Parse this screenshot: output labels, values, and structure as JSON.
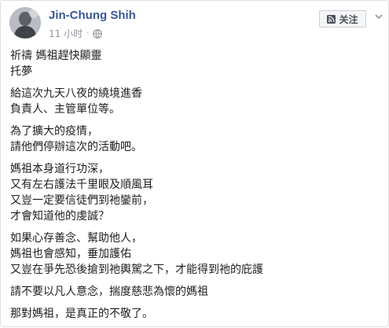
{
  "post": {
    "author": "Jin-Chung Shih",
    "timestamp": "11 小时",
    "privacy_icon": "globe-icon",
    "follow_label": "关注",
    "follow_icon": "rss-icon",
    "more_icon": "chevron-down-icon",
    "paragraphs": [
      [
        "祈禱 媽祖趕快顯靈",
        "托夢"
      ],
      [
        "給這次九天八夜的繞境進香",
        "負責人、主管單位等。"
      ],
      [
        "為了擴大的疫情，",
        "請他們停辦這次的活動吧。"
      ],
      [
        "媽祖本身道行功深，",
        "又有左右護法千里眼及順風耳",
        "又豈一定要信徒們到祂鑾前，",
        "才會知道他的虔誠？"
      ],
      [
        "如果心存善念、幫助他人，",
        "媽祖也會感知，垂加護佑",
        "又豈在爭先恐後搶到祂輿駕之下，才能得到祂的庇護"
      ],
      [
        "請不要以凡人意念，揣度慈悲為懷的媽祖"
      ],
      [
        "那對媽祖，是真正的不敬了。"
      ]
    ]
  }
}
